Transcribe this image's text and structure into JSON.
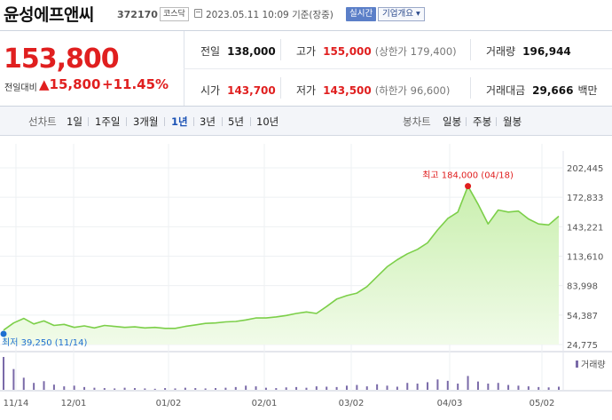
{
  "stock": {
    "name": "윤성에프앤씨",
    "code": "372170",
    "market": "코스닥",
    "datetime": "2023.05.11 10:09",
    "basis": "기준(장중)",
    "realtime_button": "실시간",
    "company_info_button": "기업개요 ▾"
  },
  "quote": {
    "price": "153,800",
    "change_label": "전일대비",
    "change": "▲15,800",
    "change_pct": "+11.45%",
    "prev_close_label": "전일",
    "prev_close": "138,000",
    "high_label": "고가",
    "high": "155,000",
    "upper_limit": "(상한가 179,400)",
    "volume_label": "거래량",
    "volume": "196,944",
    "open_label": "시가",
    "open": "143,700",
    "low_label": "저가",
    "low": "143,500",
    "lower_limit": "(하한가 96,600)",
    "amount_label": "거래대금",
    "amount": "29,666",
    "amount_unit": "백만"
  },
  "tabs": {
    "line_label": "선차트",
    "line_periods": [
      "1일",
      "1주일",
      "3개월",
      "1년",
      "3년",
      "5년",
      "10년"
    ],
    "selected": "1년",
    "candle_label": "봉차트",
    "candle_periods": [
      "일봉",
      "주봉",
      "월봉"
    ]
  },
  "colors": {
    "up": "#e01f1f",
    "line": "#7ccf49",
    "fill_top": "#c9efae",
    "fill_bottom": "#f1fbe9",
    "volume": "#7a6aa8",
    "low_marker": "#1f6fd1",
    "high_marker": "#e01f1f"
  },
  "chart_data": {
    "type": "area",
    "title": "",
    "y_ticks": [
      "202,445",
      "172,833",
      "143,221",
      "113,610",
      "83,998",
      "54,387",
      "24,775"
    ],
    "ylim": [
      24775,
      202445
    ],
    "x_labels": [
      "11/14",
      "12/01",
      "01/02",
      "02/01",
      "03/02",
      "04/03",
      "05/02"
    ],
    "max_annotation": "최고 184,000 (04/18)",
    "min_annotation": "최저 39,250 (11/14)",
    "volume_legend": "거래량",
    "x": [
      "11/14",
      "11/16",
      "11/18",
      "11/21",
      "11/23",
      "11/25",
      "11/28",
      "11/30",
      "12/02",
      "12/06",
      "12/09",
      "12/13",
      "12/16",
      "12/20",
      "12/23",
      "12/27",
      "12/30",
      "01/04",
      "01/09",
      "01/12",
      "01/17",
      "01/20",
      "01/25",
      "01/30",
      "02/02",
      "02/06",
      "02/09",
      "02/14",
      "02/17",
      "02/22",
      "02/27",
      "03/02",
      "03/06",
      "03/09",
      "03/13",
      "03/16",
      "03/20",
      "03/23",
      "03/27",
      "03/30",
      "04/03",
      "04/05",
      "04/07",
      "04/10",
      "04/12",
      "04/14",
      "04/18",
      "04/20",
      "04/24",
      "04/26",
      "04/28",
      "05/02",
      "05/04",
      "05/08",
      "05/10",
      "05/11"
    ],
    "values": [
      39250,
      46500,
      51000,
      45500,
      48500,
      44000,
      45000,
      42000,
      43500,
      41500,
      44000,
      43000,
      42000,
      42500,
      41500,
      42000,
      41000,
      41000,
      43000,
      44500,
      46000,
      46500,
      47500,
      48000,
      49500,
      51500,
      51500,
      52500,
      54000,
      56000,
      57500,
      56000,
      63000,
      70500,
      74000,
      76500,
      83000,
      93000,
      103000,
      110000,
      116000,
      120500,
      127000,
      140000,
      151500,
      158000,
      184000,
      166000,
      146000,
      160000,
      158000,
      159000,
      151000,
      146000,
      145000,
      153800
    ],
    "volume": [
      95,
      60,
      35,
      20,
      25,
      15,
      10,
      12,
      8,
      6,
      5,
      4,
      6,
      5,
      4,
      3,
      5,
      4,
      6,
      5,
      4,
      5,
      6,
      8,
      12,
      10,
      6,
      5,
      7,
      8,
      6,
      10,
      9,
      8,
      12,
      14,
      10,
      16,
      12,
      9,
      20,
      18,
      22,
      30,
      26,
      18,
      40,
      24,
      18,
      20,
      14,
      12,
      10,
      8,
      7,
      9
    ]
  }
}
